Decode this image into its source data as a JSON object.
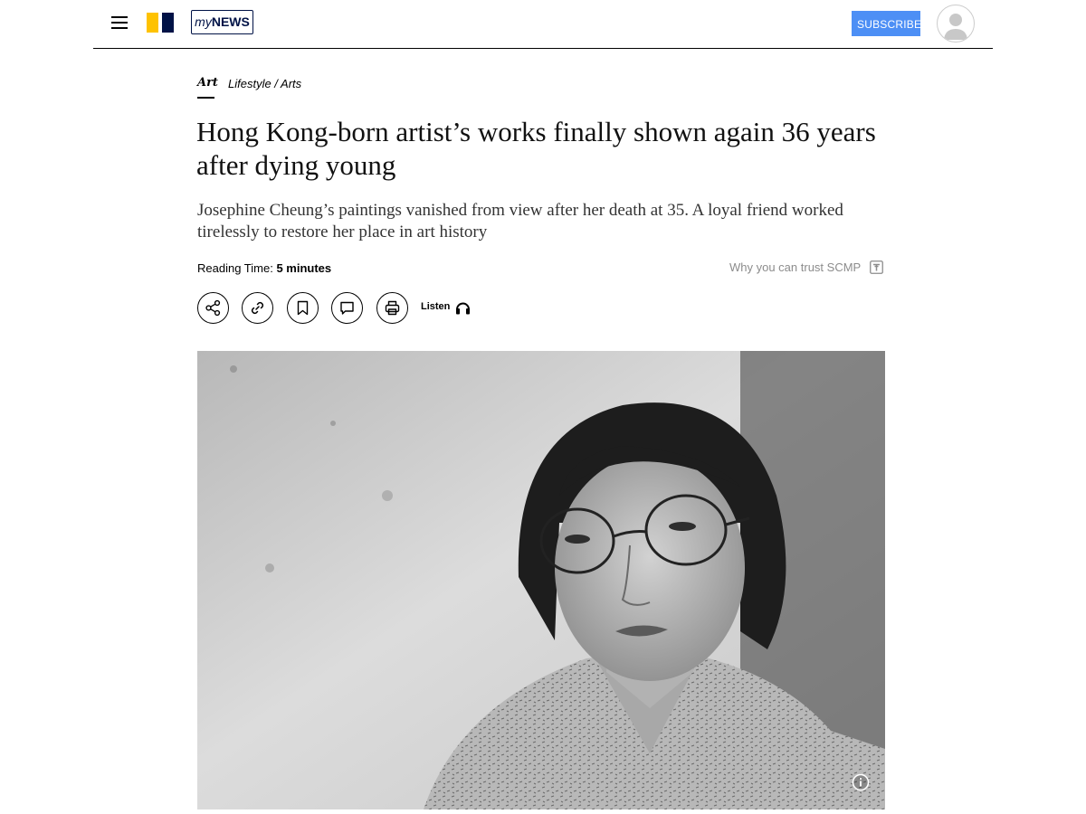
{
  "header": {
    "menu_icon": "hamburger-icon",
    "logo_icon": "scmp-logo",
    "mynews_my": "my",
    "mynews_news": "NEWS",
    "subscribe_label": "SUBSCRIBE",
    "account_icon": "user-avatar-icon",
    "colors": {
      "logo_yellow": "#fec200",
      "logo_navy": "#001246",
      "subscribe_blue": "#4d8ff5"
    }
  },
  "article": {
    "section": "Art",
    "breadcrumb": "Lifestyle / Arts",
    "headline": "Hong Kong-born artist’s works finally shown again 36 years after dying young",
    "subheadline": "Josephine Cheung’s paintings vanished from view after her death at 35. A loyal friend worked tirelessly to restore her place in art history",
    "reading_time_label": "Reading Time:",
    "reading_time_value": "5 minutes",
    "trust_label": "Why you can trust SCMP",
    "trust_icon": "trust-badge-icon",
    "actions": [
      {
        "icon": "share-icon"
      },
      {
        "icon": "link-icon"
      },
      {
        "icon": "bookmark-icon"
      },
      {
        "icon": "comment-icon"
      },
      {
        "icon": "print-icon"
      }
    ],
    "listen_label": "Listen",
    "listen_icon": "headphones-icon",
    "hero_image": {
      "description_icon": "info-icon"
    }
  }
}
